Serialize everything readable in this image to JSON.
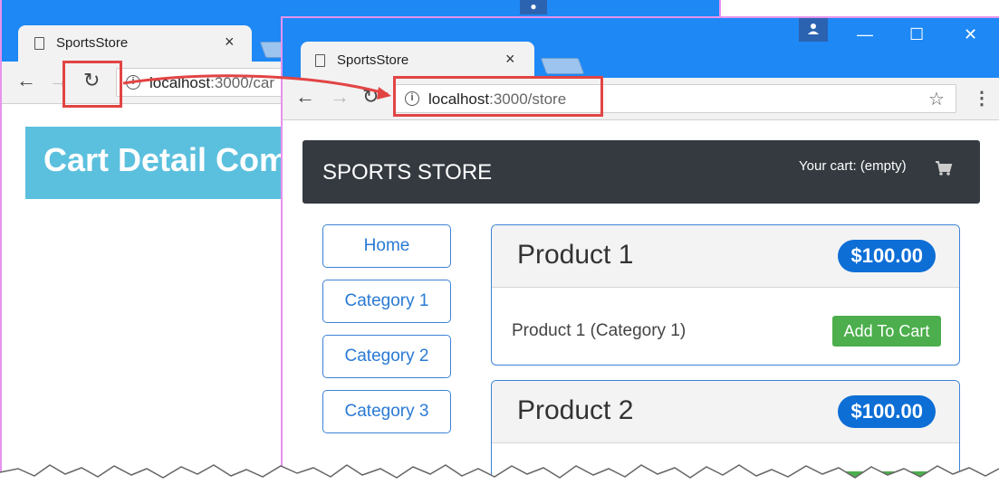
{
  "back_window": {
    "tab_title": "SportsStore",
    "tab_close": "×",
    "url_host": "localhost",
    "url_path": ":3000/car",
    "header_text": "Cart Detail Com"
  },
  "front_window": {
    "tab_title": "SportsStore",
    "tab_close": "×",
    "url_host": "localhost",
    "url_path": ":3000/store",
    "brand": "SPORTS STORE",
    "cart_summary": "Your cart: (empty)",
    "categories": [
      "Home",
      "Category 1",
      "Category 2",
      "Category 3"
    ],
    "products": [
      {
        "name": "Product 1",
        "price": "$100.00",
        "description": "Product 1 (Category 1)",
        "button": "Add To Cart"
      },
      {
        "name": "Product 2",
        "price": "$100.00",
        "description": "",
        "button": ""
      }
    ]
  },
  "icons": {
    "tab_page": "page-icon",
    "back": "←",
    "forward": "→",
    "reload": "↻",
    "info": "i",
    "star": "☆",
    "menu": "⋮",
    "minimize": "—",
    "maximize": "☐",
    "close": "✕",
    "cart": "cart-icon",
    "profile": "person-icon"
  },
  "colors": {
    "chrome_blue": "#1e88f5",
    "highlight_red": "#e24444",
    "navbar_dark": "#343a40",
    "info_blue": "#5bc0de",
    "price_blue": "#0d6ed6",
    "success_green": "#4cae4c"
  }
}
